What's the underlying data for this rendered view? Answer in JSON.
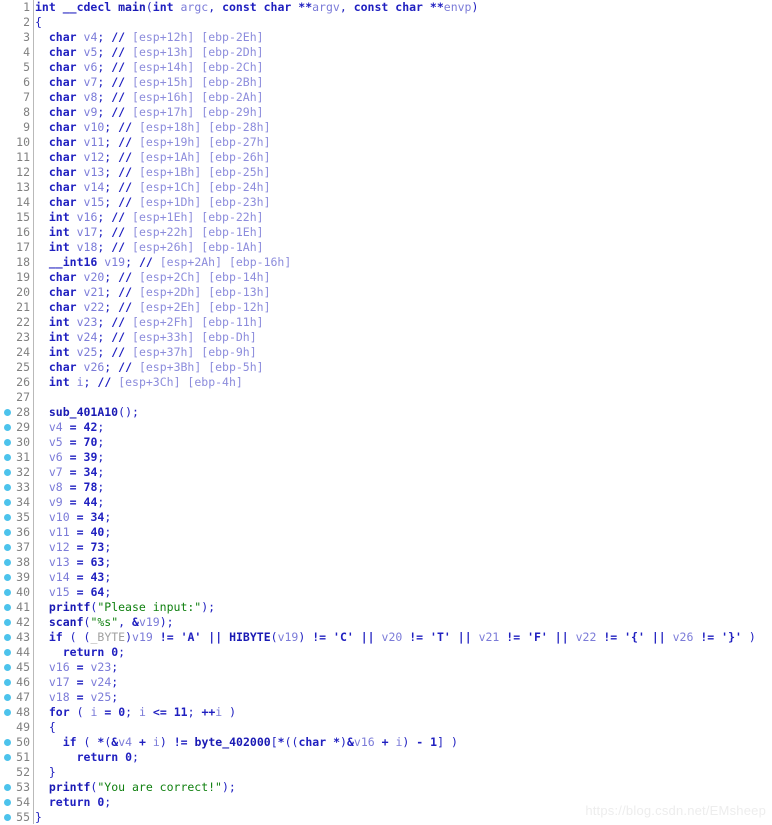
{
  "app": {
    "view": "pseudocode-decompiler",
    "watermark": "https://blog.csdn.net/EMsheep"
  },
  "theme": {
    "background": "#ffffff",
    "gutter_text": "#808080",
    "gutter_rule": "#b9b9b9",
    "breakpoint_dot": "#4cc3ec",
    "keyword": "#2020c0",
    "function": "#1a1ab4",
    "variable": "#7b7bd8",
    "string": "#108010",
    "comment": "#8c8cdc",
    "type": "#a0a0a0",
    "watermark": "#ededed"
  },
  "code": {
    "language": "c-pseudocode",
    "first_line": 1,
    "last_line": 55,
    "lines": [
      {
        "n": 1,
        "dot": false,
        "text": "int __cdecl main(int argc, const char **argv, const char **envp)"
      },
      {
        "n": 2,
        "dot": false,
        "text": "{"
      },
      {
        "n": 3,
        "dot": false,
        "text": "  char v4; // [esp+12h] [ebp-2Eh]"
      },
      {
        "n": 4,
        "dot": false,
        "text": "  char v5; // [esp+13h] [ebp-2Dh]"
      },
      {
        "n": 5,
        "dot": false,
        "text": "  char v6; // [esp+14h] [ebp-2Ch]"
      },
      {
        "n": 6,
        "dot": false,
        "text": "  char v7; // [esp+15h] [ebp-2Bh]"
      },
      {
        "n": 7,
        "dot": false,
        "text": "  char v8; // [esp+16h] [ebp-2Ah]"
      },
      {
        "n": 8,
        "dot": false,
        "text": "  char v9; // [esp+17h] [ebp-29h]"
      },
      {
        "n": 9,
        "dot": false,
        "text": "  char v10; // [esp+18h] [ebp-28h]"
      },
      {
        "n": 10,
        "dot": false,
        "text": "  char v11; // [esp+19h] [ebp-27h]"
      },
      {
        "n": 11,
        "dot": false,
        "text": "  char v12; // [esp+1Ah] [ebp-26h]"
      },
      {
        "n": 12,
        "dot": false,
        "text": "  char v13; // [esp+1Bh] [ebp-25h]"
      },
      {
        "n": 13,
        "dot": false,
        "text": "  char v14; // [esp+1Ch] [ebp-24h]"
      },
      {
        "n": 14,
        "dot": false,
        "text": "  char v15; // [esp+1Dh] [ebp-23h]"
      },
      {
        "n": 15,
        "dot": false,
        "text": "  int v16; // [esp+1Eh] [ebp-22h]"
      },
      {
        "n": 16,
        "dot": false,
        "text": "  int v17; // [esp+22h] [ebp-1Eh]"
      },
      {
        "n": 17,
        "dot": false,
        "text": "  int v18; // [esp+26h] [ebp-1Ah]"
      },
      {
        "n": 18,
        "dot": false,
        "text": "  __int16 v19; // [esp+2Ah] [ebp-16h]"
      },
      {
        "n": 19,
        "dot": false,
        "text": "  char v20; // [esp+2Ch] [ebp-14h]"
      },
      {
        "n": 20,
        "dot": false,
        "text": "  char v21; // [esp+2Dh] [ebp-13h]"
      },
      {
        "n": 21,
        "dot": false,
        "text": "  char v22; // [esp+2Eh] [ebp-12h]"
      },
      {
        "n": 22,
        "dot": false,
        "text": "  int v23; // [esp+2Fh] [ebp-11h]"
      },
      {
        "n": 23,
        "dot": false,
        "text": "  int v24; // [esp+33h] [ebp-Dh]"
      },
      {
        "n": 24,
        "dot": false,
        "text": "  int v25; // [esp+37h] [ebp-9h]"
      },
      {
        "n": 25,
        "dot": false,
        "text": "  char v26; // [esp+3Bh] [ebp-5h]"
      },
      {
        "n": 26,
        "dot": false,
        "text": "  int i; // [esp+3Ch] [ebp-4h]"
      },
      {
        "n": 27,
        "dot": false,
        "text": ""
      },
      {
        "n": 28,
        "dot": true,
        "text": "  sub_401A10();"
      },
      {
        "n": 29,
        "dot": true,
        "text": "  v4 = 42;"
      },
      {
        "n": 30,
        "dot": true,
        "text": "  v5 = 70;"
      },
      {
        "n": 31,
        "dot": true,
        "text": "  v6 = 39;"
      },
      {
        "n": 32,
        "dot": true,
        "text": "  v7 = 34;"
      },
      {
        "n": 33,
        "dot": true,
        "text": "  v8 = 78;"
      },
      {
        "n": 34,
        "dot": true,
        "text": "  v9 = 44;"
      },
      {
        "n": 35,
        "dot": true,
        "text": "  v10 = 34;"
      },
      {
        "n": 36,
        "dot": true,
        "text": "  v11 = 40;"
      },
      {
        "n": 37,
        "dot": true,
        "text": "  v12 = 73;"
      },
      {
        "n": 38,
        "dot": true,
        "text": "  v13 = 63;"
      },
      {
        "n": 39,
        "dot": true,
        "text": "  v14 = 43;"
      },
      {
        "n": 40,
        "dot": true,
        "text": "  v15 = 64;"
      },
      {
        "n": 41,
        "dot": true,
        "text": "  printf(\"Please input:\");"
      },
      {
        "n": 42,
        "dot": true,
        "text": "  scanf(\"%s\", &v19);"
      },
      {
        "n": 43,
        "dot": true,
        "text": "  if ( (_BYTE)v19 != 'A' || HIBYTE(v19) != 'C' || v20 != 'T' || v21 != 'F' || v22 != '{' || v26 != '}' )"
      },
      {
        "n": 44,
        "dot": true,
        "text": "    return 0;"
      },
      {
        "n": 45,
        "dot": true,
        "text": "  v16 = v23;"
      },
      {
        "n": 46,
        "dot": true,
        "text": "  v17 = v24;"
      },
      {
        "n": 47,
        "dot": true,
        "text": "  v18 = v25;"
      },
      {
        "n": 48,
        "dot": true,
        "text": "  for ( i = 0; i <= 11; ++i )"
      },
      {
        "n": 49,
        "dot": false,
        "text": "  {"
      },
      {
        "n": 50,
        "dot": true,
        "text": "    if ( *(&v4 + i) != byte_402000[*((char *)&v16 + i) - 1] )"
      },
      {
        "n": 51,
        "dot": true,
        "text": "      return 0;"
      },
      {
        "n": 52,
        "dot": false,
        "text": "  }"
      },
      {
        "n": 53,
        "dot": true,
        "text": "  printf(\"You are correct!\");"
      },
      {
        "n": 54,
        "dot": true,
        "text": "  return 0;"
      },
      {
        "n": 55,
        "dot": true,
        "text": "}"
      }
    ]
  },
  "tokens": {
    "keywords": [
      "int",
      "char",
      "const",
      "for",
      "if",
      "return",
      "__cdecl",
      "__int16"
    ],
    "functions": [
      "main",
      "sub_401A10",
      "printf",
      "scanf",
      "HIBYTE",
      "byte_402000"
    ],
    "types": [
      "_BYTE",
      "char"
    ],
    "strings": [
      "\"Please input:\"",
      "\"%s\"",
      "\"You are correct!\""
    ],
    "char_literals": [
      "'A'",
      "'C'",
      "'T'",
      "'F'",
      "'{'",
      "'}'"
    ],
    "variables": [
      "v4",
      "v5",
      "v6",
      "v7",
      "v8",
      "v9",
      "v10",
      "v11",
      "v12",
      "v13",
      "v14",
      "v15",
      "v16",
      "v17",
      "v18",
      "v19",
      "v20",
      "v21",
      "v22",
      "v23",
      "v24",
      "v25",
      "v26",
      "i",
      "argc",
      "argv",
      "envp"
    ]
  }
}
